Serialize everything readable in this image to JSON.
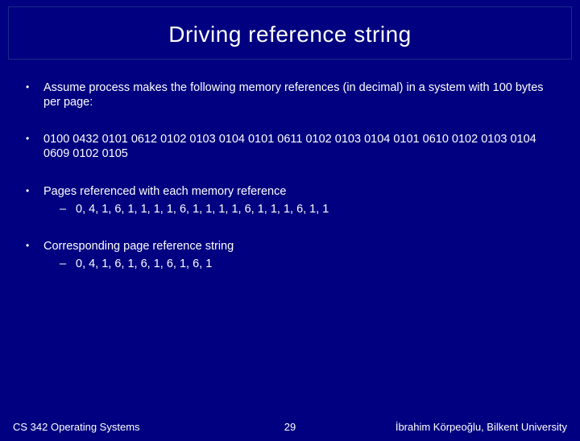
{
  "title": "Driving reference string",
  "bullets": [
    {
      "text": "Assume process makes the following memory references (in decimal) in a system with 100 bytes per page:"
    },
    {
      "text": "0100  0432  0101  0612  0102  0103  0104  0101  0611  0102  0103  0104  0101  0610  0102  0103  0104  0609  0102  0105"
    },
    {
      "text": "Pages referenced with each memory reference",
      "sub": "0, 4, 1, 6, 1, 1, 1, 1, 6, 1, 1, 1, 1, 6, 1, 1, 1, 6, 1, 1"
    },
    {
      "text": "Corresponding page reference string",
      "sub": "0, 4, 1, 6, 1, 6, 1, 6, 1, 6, 1"
    }
  ],
  "footer": {
    "left": "CS 342 Operating Systems",
    "page": "29",
    "right": "İbrahim Körpeoğlu, Bilkent University"
  }
}
